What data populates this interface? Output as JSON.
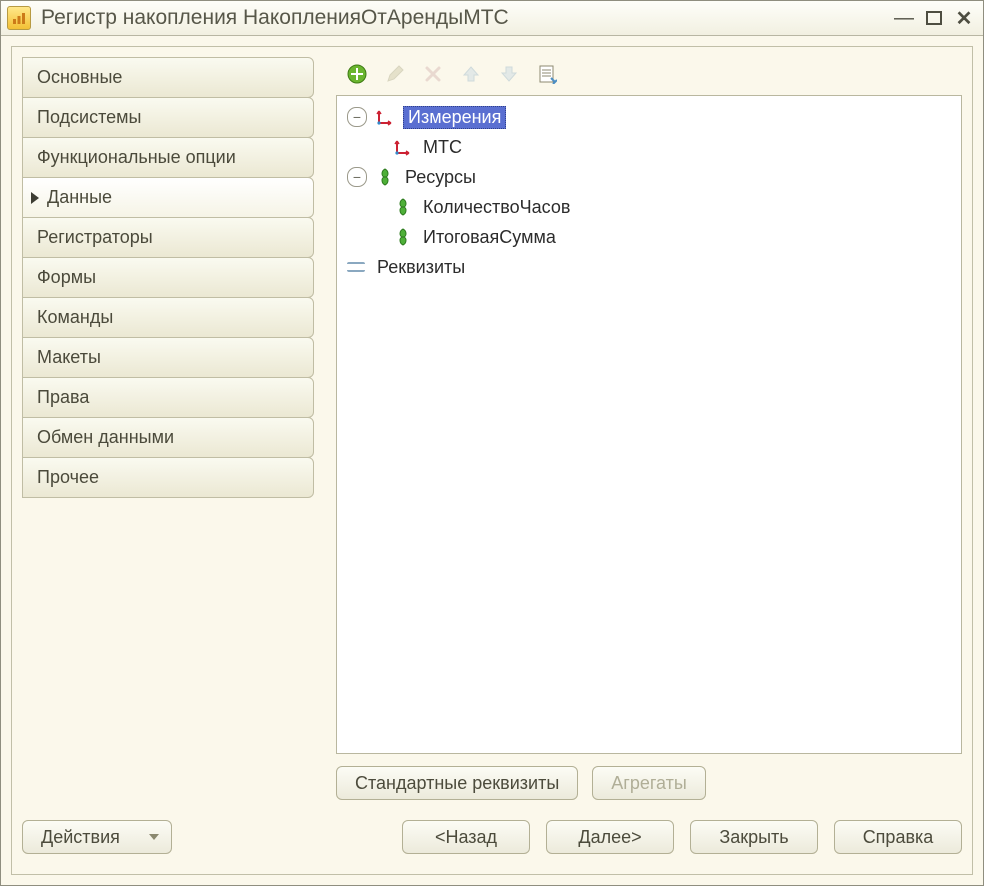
{
  "title": "Регистр накопления НакопленияОтАрендыМТС",
  "nav": {
    "items": [
      {
        "label": "Основные"
      },
      {
        "label": "Подсистемы"
      },
      {
        "label": "Функциональные опции"
      },
      {
        "label": "Данные"
      },
      {
        "label": "Регистраторы"
      },
      {
        "label": "Формы"
      },
      {
        "label": "Команды"
      },
      {
        "label": "Макеты"
      },
      {
        "label": "Права"
      },
      {
        "label": "Обмен данными"
      },
      {
        "label": "Прочее"
      }
    ],
    "active_index": 3
  },
  "tree": {
    "dimensions_label": "Измерения",
    "dimensions_items": [
      "МТС"
    ],
    "resources_label": "Ресурсы",
    "resources_items": [
      "КоличествоЧасов",
      "ИтоговаяСумма"
    ],
    "attributes_label": "Реквизиты"
  },
  "buttons": {
    "standard_attrs": "Стандартные реквизиты",
    "aggregates": "Агрегаты",
    "actions": "Действия",
    "back": "<Назад",
    "next": "Далее>",
    "close": "Закрыть",
    "help": "Справка"
  }
}
